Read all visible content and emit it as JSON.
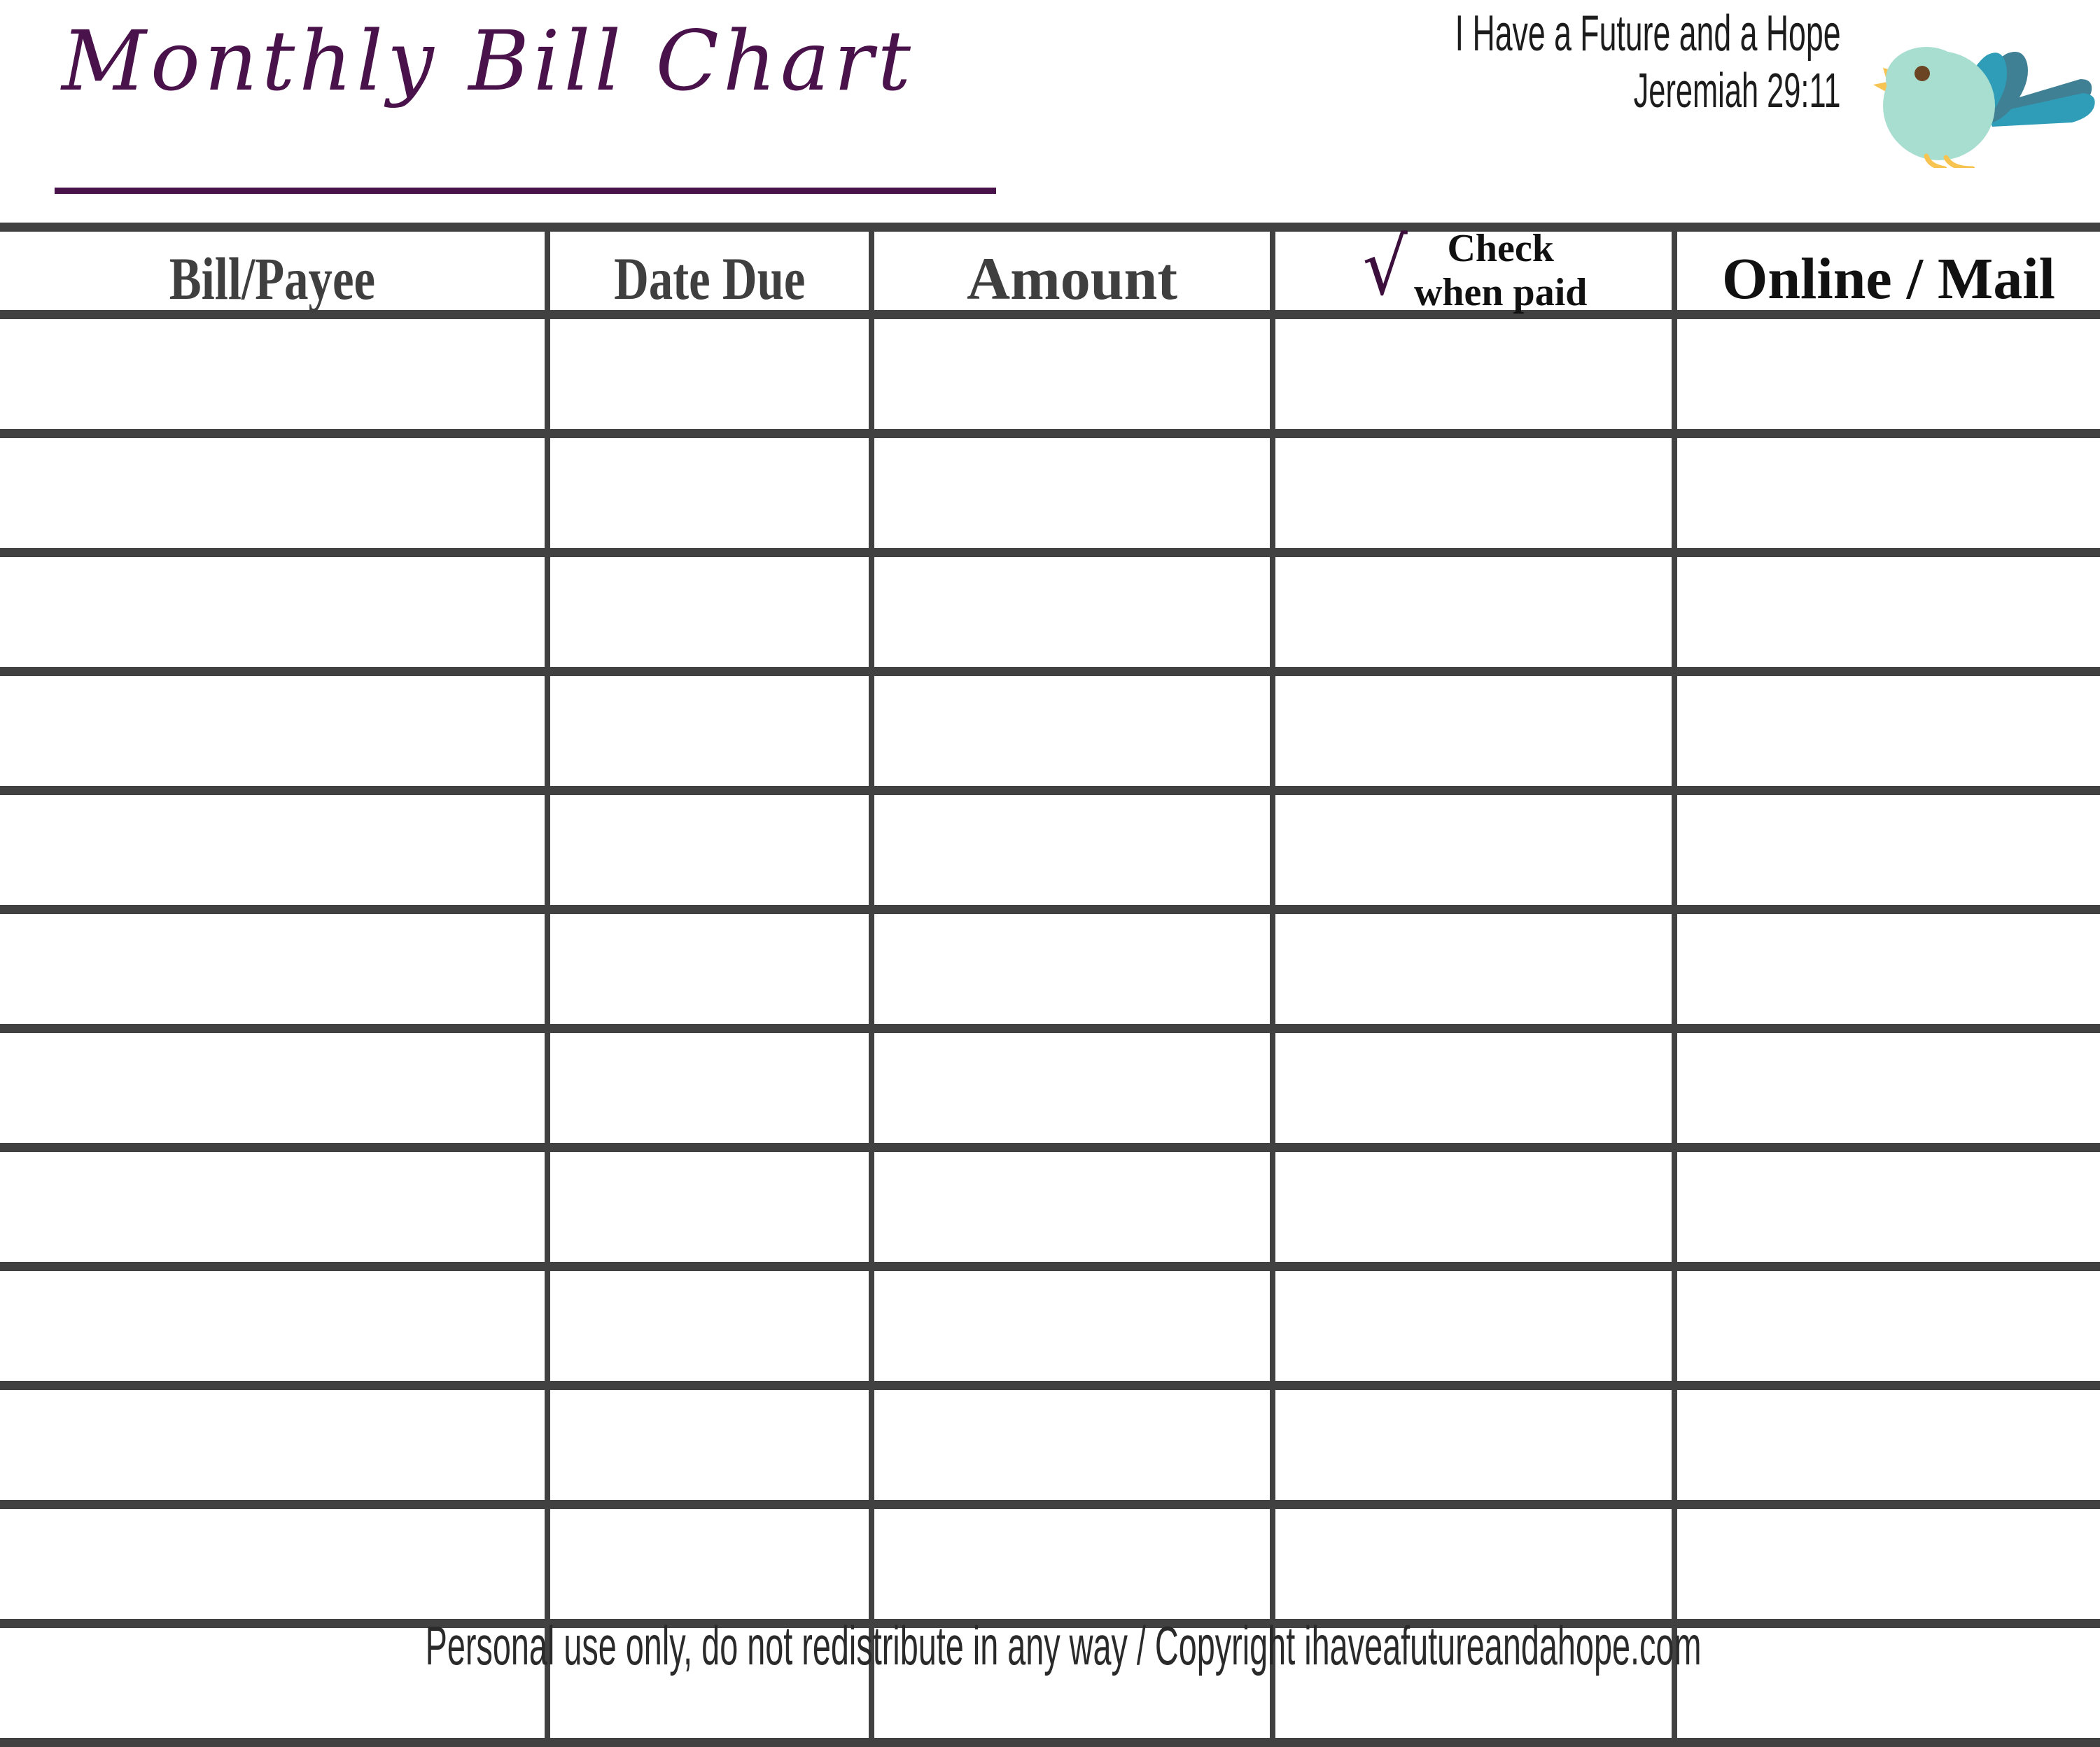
{
  "header": {
    "title": "Monthly Bill Chart",
    "verse_line_1": "I Have a Future and a Hope",
    "verse_line_2": "Jeremiah 29:11",
    "bird_icon": "bird-icon",
    "title_color": "#4a124a",
    "accent_color": "#3d0f3d"
  },
  "table": {
    "columns": [
      {
        "key": "bill_payee",
        "label": "Bill/Payee"
      },
      {
        "key": "date_due",
        "label": "Date Due"
      },
      {
        "key": "amount",
        "label": "Amount"
      },
      {
        "key": "check_when_paid",
        "label": "Check when paid",
        "label_line_1": "Check",
        "label_line_2": "when paid",
        "check_glyph": "√"
      },
      {
        "key": "online_mail",
        "label": "Online / Mail"
      }
    ],
    "rows": [
      {
        "bill_payee": "",
        "date_due": "",
        "amount": "",
        "check_when_paid": "",
        "online_mail": ""
      },
      {
        "bill_payee": "",
        "date_due": "",
        "amount": "",
        "check_when_paid": "",
        "online_mail": ""
      },
      {
        "bill_payee": "",
        "date_due": "",
        "amount": "",
        "check_when_paid": "",
        "online_mail": ""
      },
      {
        "bill_payee": "",
        "date_due": "",
        "amount": "",
        "check_when_paid": "",
        "online_mail": ""
      },
      {
        "bill_payee": "",
        "date_due": "",
        "amount": "",
        "check_when_paid": "",
        "online_mail": ""
      },
      {
        "bill_payee": "",
        "date_due": "",
        "amount": "",
        "check_when_paid": "",
        "online_mail": ""
      },
      {
        "bill_payee": "",
        "date_due": "",
        "amount": "",
        "check_when_paid": "",
        "online_mail": ""
      },
      {
        "bill_payee": "",
        "date_due": "",
        "amount": "",
        "check_when_paid": "",
        "online_mail": ""
      },
      {
        "bill_payee": "",
        "date_due": "",
        "amount": "",
        "check_when_paid": "",
        "online_mail": ""
      },
      {
        "bill_payee": "",
        "date_due": "",
        "amount": "",
        "check_when_paid": "",
        "online_mail": ""
      },
      {
        "bill_payee": "",
        "date_due": "",
        "amount": "",
        "check_when_paid": "",
        "online_mail": ""
      },
      {
        "bill_payee": "",
        "date_due": "",
        "amount": "",
        "check_when_paid": "",
        "online_mail": ""
      }
    ],
    "row_count": 12,
    "grid_color": "#414141"
  },
  "footer": {
    "notice": "Personal use only, do not redistribute in any way / Copyright ihaveafutureandahope.com"
  },
  "colors": {
    "bird_body": "#a8ded0",
    "bird_wing_front": "#3e9fb5",
    "bird_wing_back": "#3f8094",
    "bird_beak": "#f8c451",
    "bird_eye": "#6b4423",
    "purple": "#4a124a",
    "grid": "#414141"
  }
}
